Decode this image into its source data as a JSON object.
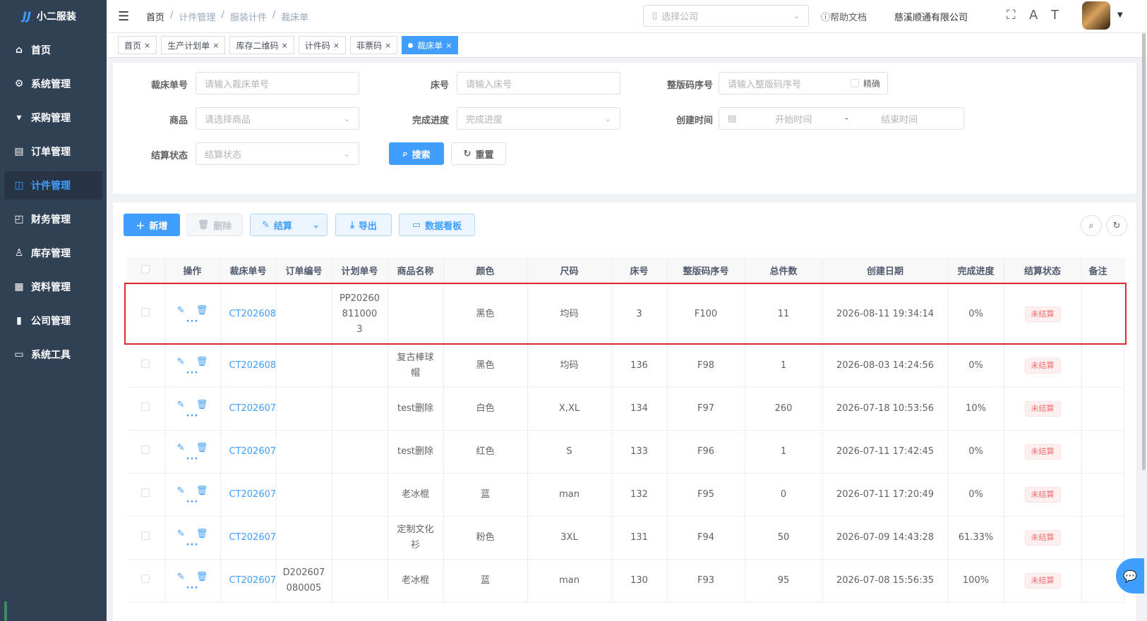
{
  "app": {
    "logo_text": "小二服装",
    "logo_mark": "JJ"
  },
  "sidebar": {
    "items": [
      {
        "label": "首页",
        "icon": "dashboard-icon",
        "active": false
      },
      {
        "label": "系统管理",
        "icon": "gear-icon",
        "active": false
      },
      {
        "label": "采购管理",
        "icon": "cart-icon",
        "active": false
      },
      {
        "label": "订单管理",
        "icon": "order-icon",
        "active": false
      },
      {
        "label": "计件管理",
        "icon": "book-icon",
        "active": true
      },
      {
        "label": "财务管理",
        "icon": "chart-icon",
        "active": false
      },
      {
        "label": "库存管理",
        "icon": "user-icon",
        "active": false
      },
      {
        "label": "资料管理",
        "icon": "document-icon",
        "active": false
      },
      {
        "label": "公司管理",
        "icon": "bar-chart-icon",
        "active": false
      },
      {
        "label": "系统工具",
        "icon": "toolbox-icon",
        "active": false
      }
    ]
  },
  "header": {
    "breadcrumb": [
      "首页",
      "计件管理",
      "服装计件",
      "裁床单"
    ],
    "company_placeholder": "选择公司",
    "help_label": "帮助文档",
    "company_name": "慈溪顺通有限公司"
  },
  "tags": [
    {
      "label": "首页",
      "active": false
    },
    {
      "label": "生产计划单",
      "active": false
    },
    {
      "label": "库存二维码",
      "active": false
    },
    {
      "label": "计件码",
      "active": false
    },
    {
      "label": "菲票码",
      "active": false
    },
    {
      "label": "裁床单",
      "active": true
    }
  ],
  "search": {
    "cut_no_label": "裁床单号",
    "cut_no_placeholder": "请输入裁床单号",
    "bed_no_label": "床号",
    "bed_no_placeholder": "请输入床号",
    "plate_no_label": "整版码序号",
    "plate_no_placeholder": "请输入整版码序号",
    "exact_label": "精确",
    "product_label": "商品",
    "product_placeholder": "请选择商品",
    "progress_label": "完成进度",
    "progress_placeholder": "完成进度",
    "created_label": "创建时间",
    "start_placeholder": "开始时间",
    "range_sep": "-",
    "end_placeholder": "结束时间",
    "settle_label": "结算状态",
    "settle_placeholder": "结算状态",
    "search_button": "搜索",
    "reset_button": "重置"
  },
  "toolbar": {
    "add_label": "新增",
    "delete_label": "删除",
    "settle_label": "结算",
    "export_label": "导出",
    "dashboard_label": "数据看板"
  },
  "table": {
    "headers": [
      "操作",
      "裁床单号",
      "订单编号",
      "计划单号",
      "商品名称",
      "颜色",
      "尺码",
      "床号",
      "整版码序号",
      "总件数",
      "创建日期",
      "完成进度",
      "结算状态",
      "备注"
    ],
    "rows": [
      {
        "cut_no": "CT202608",
        "order_no": "",
        "plan_no": "PP20260811000 3",
        "product": "",
        "color": "黑色",
        "size": "均码",
        "bed": "3",
        "plate": "F100",
        "total": "11",
        "created": "2026-08-11 19:34:14",
        "progress": "0%",
        "status": "未结算",
        "remark": ""
      },
      {
        "cut_no": "CT202608",
        "order_no": "",
        "plan_no": "",
        "product": "复古棒球帽",
        "color": "黑色",
        "size": "均码",
        "bed": "136",
        "plate": "F98",
        "total": "1",
        "created": "2026-08-03 14:24:56",
        "progress": "0%",
        "status": "未结算",
        "remark": ""
      },
      {
        "cut_no": "CT202607",
        "order_no": "",
        "plan_no": "",
        "product": "test删除",
        "color": "白色",
        "size": "X,XL",
        "bed": "134",
        "plate": "F97",
        "total": "260",
        "created": "2026-07-18 10:53:56",
        "progress": "10%",
        "status": "未结算",
        "remark": ""
      },
      {
        "cut_no": "CT202607",
        "order_no": "",
        "plan_no": "",
        "product": "test删除",
        "color": "红色",
        "size": "S",
        "bed": "133",
        "plate": "F96",
        "total": "1",
        "created": "2026-07-11 17:42:45",
        "progress": "0%",
        "status": "未结算",
        "remark": ""
      },
      {
        "cut_no": "CT202607",
        "order_no": "",
        "plan_no": "",
        "product": "老冰棍",
        "color": "蓝",
        "size": "man",
        "bed": "132",
        "plate": "F95",
        "total": "0",
        "created": "2026-07-11 17:20:49",
        "progress": "0%",
        "status": "未结算",
        "remark": ""
      },
      {
        "cut_no": "CT202607",
        "order_no": "",
        "plan_no": "",
        "product": "定制文化衫",
        "color": "粉色",
        "size": "3XL",
        "bed": "131",
        "plate": "F94",
        "total": "50",
        "created": "2026-07-09 14:43:28",
        "progress": "61.33%",
        "status": "未结算",
        "remark": ""
      },
      {
        "cut_no": "CT202607",
        "order_no": "D202607080005",
        "plan_no": "",
        "product": "老冰棍",
        "color": "蓝",
        "size": "man",
        "bed": "130",
        "plate": "F93",
        "total": "95",
        "created": "2026-07-08 15:56:35",
        "progress": "100%",
        "status": "未结算",
        "remark": ""
      }
    ]
  }
}
